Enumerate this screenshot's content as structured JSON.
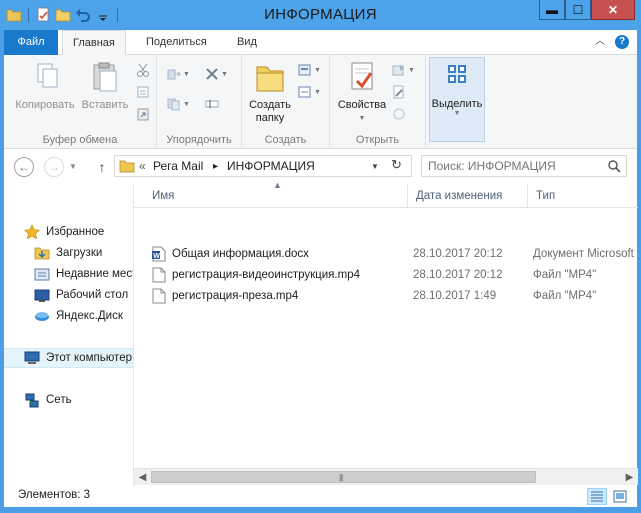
{
  "window": {
    "title": "ИНФОРМАЦИЯ",
    "controls": {
      "minimize": "▬",
      "maximize": "☐",
      "close": "✕"
    }
  },
  "ribbon": {
    "tabs": [
      {
        "label": "Файл"
      },
      {
        "label": "Главная"
      },
      {
        "label": "Поделиться"
      },
      {
        "label": "Вид"
      }
    ],
    "groups": {
      "clipboard": {
        "label": "Буфер обмена",
        "copy": "Копировать",
        "paste": "Вставить"
      },
      "organize": {
        "label": "Упорядочить"
      },
      "new": {
        "label": "Создать",
        "new_folder_line1": "Создать",
        "new_folder_line2": "папку"
      },
      "open": {
        "label": "Открыть",
        "properties": "Свойства"
      },
      "select": {
        "label": "Выделить"
      }
    }
  },
  "address": {
    "overflow": "«",
    "crumbs": [
      "Рега Mail",
      "ИНФОРМАЦИЯ"
    ],
    "separator": "▸"
  },
  "search": {
    "placeholder": "Поиск: ИНФОРМАЦИЯ"
  },
  "nav_pane": {
    "items": [
      {
        "label": "Избранное",
        "icon": "star-icon"
      },
      {
        "label": "Загрузки",
        "icon": "downloads-icon"
      },
      {
        "label": "Недавние места",
        "icon": "recent-places-icon"
      },
      {
        "label": "Рабочий стол",
        "icon": "desktop-icon"
      },
      {
        "label": "Яндекс.Диск",
        "icon": "yandex-disk-icon"
      },
      {
        "label": "Этот компьютер",
        "icon": "computer-icon"
      },
      {
        "label": "Сеть",
        "icon": "network-icon"
      }
    ]
  },
  "file_list": {
    "columns": [
      "Имя",
      "Дата изменения",
      "Тип"
    ],
    "sort_indicator": "▲",
    "rows": [
      {
        "name": "Общая информация.docx",
        "modified": "28.10.2017 20:12",
        "type": "Документ Microsoft Word",
        "icon": "word-doc-icon"
      },
      {
        "name": "регистрация-видеоинструкция.mp4",
        "modified": "28.10.2017 20:12",
        "type": "Файл \"MP4\"",
        "icon": "blank-file-icon"
      },
      {
        "name": "регистрация-преза.mp4",
        "modified": "28.10.2017 1:49",
        "type": "Файл \"MP4\"",
        "icon": "blank-file-icon"
      }
    ]
  },
  "scrollbar": {
    "left_arrow": "◀",
    "right_arrow": "▶",
    "grip": "|||"
  },
  "status": {
    "item_count": "Элементов: 3"
  },
  "colors": {
    "title_bar": "#4da3ea",
    "file_tab": "#1979ca",
    "close_button": "#c75050",
    "selection": "#e5f3fb"
  }
}
